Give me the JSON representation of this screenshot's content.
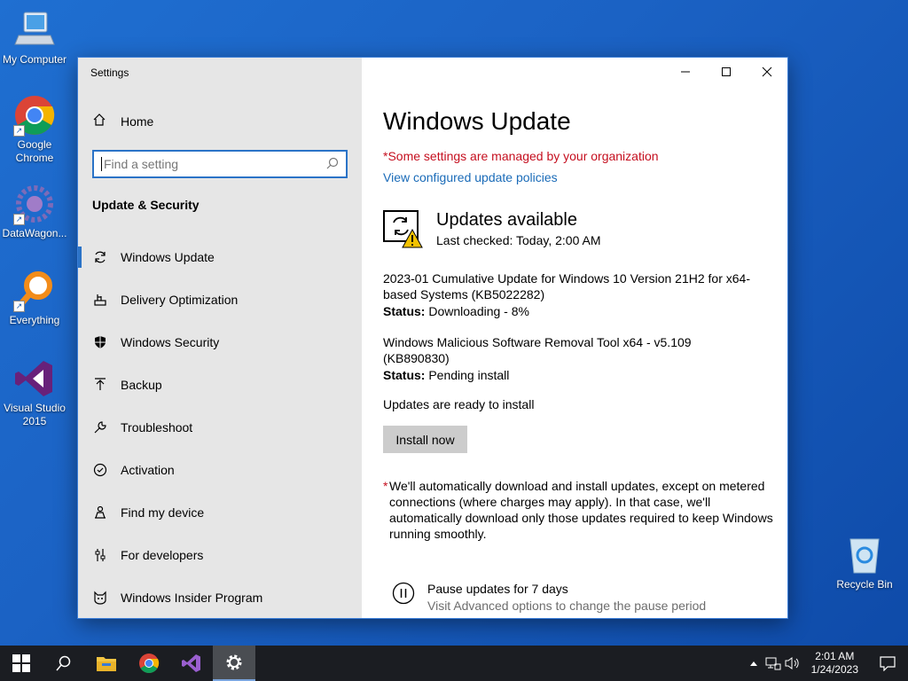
{
  "desktop": {
    "icons": [
      {
        "label": "My Computer"
      },
      {
        "label": "Google Chrome"
      },
      {
        "label": "DataWagon..."
      },
      {
        "label": "Everything"
      },
      {
        "label": "Visual Studio 2015"
      },
      {
        "label": "Recycle Bin"
      }
    ]
  },
  "window": {
    "title": "Settings",
    "controls": {
      "minimize": "—",
      "maximize": "☐",
      "close": "✕"
    }
  },
  "sidebar": {
    "home_label": "Home",
    "search_placeholder": "Find a setting",
    "section_title": "Update & Security",
    "items": [
      {
        "label": "Windows Update",
        "icon": "sync-icon",
        "active": true
      },
      {
        "label": "Delivery Optimization",
        "icon": "delivery-icon"
      },
      {
        "label": "Windows Security",
        "icon": "shield-icon"
      },
      {
        "label": "Backup",
        "icon": "backup-icon"
      },
      {
        "label": "Troubleshoot",
        "icon": "wrench-icon"
      },
      {
        "label": "Activation",
        "icon": "check-circle-icon"
      },
      {
        "label": "Find my device",
        "icon": "person-icon"
      },
      {
        "label": "For developers",
        "icon": "sliders-icon"
      },
      {
        "label": "Windows Insider Program",
        "icon": "insider-cat-icon"
      }
    ]
  },
  "main": {
    "title": "Windows Update",
    "managed_notice": "*Some settings are managed by your organization",
    "policies_link": "View configured update policies",
    "status_title": "Updates available",
    "last_checked": "Last checked: Today, 2:00 AM",
    "updates": [
      {
        "name": "2023-01 Cumulative Update for Windows 10 Version 21H2 for x64-based Systems (KB5022282)",
        "status_label": "Status:",
        "status": "Downloading - 8%"
      },
      {
        "name": "Windows Malicious Software Removal Tool x64 - v5.109 (KB890830)",
        "status_label": "Status:",
        "status": "Pending install"
      }
    ],
    "ready_text": "Updates are ready to install",
    "install_button": "Install now",
    "note_star": "*",
    "note_text": "We'll automatically download and install updates, except on metered connections (where charges may apply). In that case, we'll automatically download only those updates required to keep Windows running smoothly.",
    "pause_title": "Pause updates for 7 days",
    "pause_sub": "Visit Advanced options to change the pause period"
  },
  "taskbar": {
    "time": "2:01 AM",
    "date": "1/24/2023"
  },
  "colors": {
    "accent": "#2b73c7",
    "managed_red": "#c50f1f",
    "link_blue": "#1a6bb8",
    "taskbar_bg": "#1b1d22"
  }
}
